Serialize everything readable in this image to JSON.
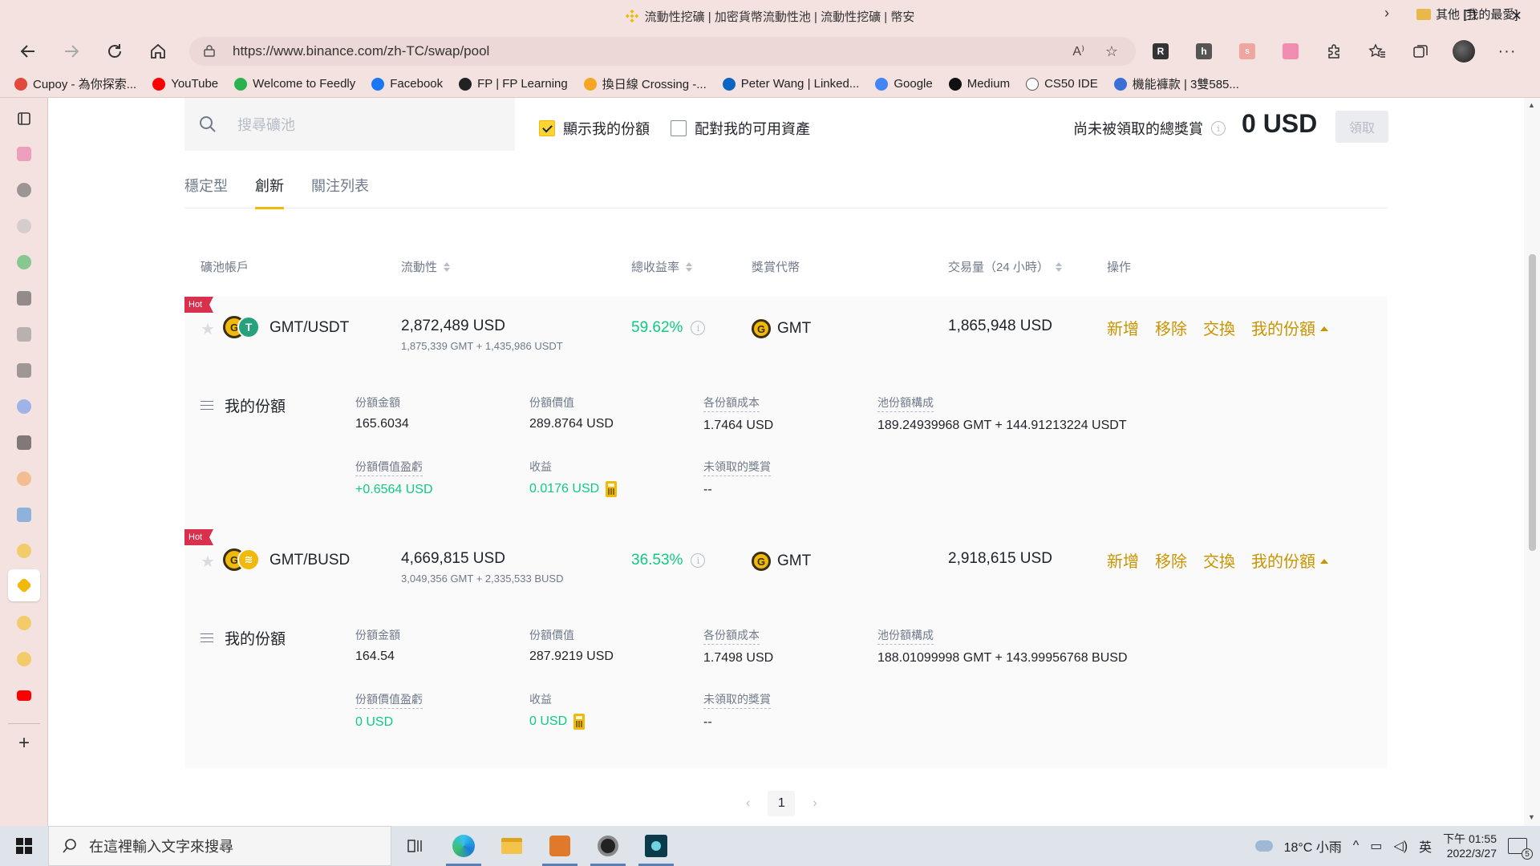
{
  "window": {
    "title": "流動性挖礦 | 加密貨幣流動性池 | 流動性挖礦 | 幣安",
    "minimize": "—",
    "maximize": "❐",
    "close": "✕"
  },
  "browser": {
    "url": "https://www.binance.com/zh-TC/swap/pool",
    "read_aloud": "A⁾",
    "fav": "☆"
  },
  "bookmarks": [
    {
      "label": "Cupoy - 為你探索...",
      "color": "#e04a3a"
    },
    {
      "label": "YouTube",
      "color": "#ff0000"
    },
    {
      "label": "Welcome to Feedly",
      "color": "#2bb24c"
    },
    {
      "label": "Facebook",
      "color": "#1877f2"
    },
    {
      "label": "FP | FP Learning",
      "color": "#222222"
    },
    {
      "label": "換日線 Crossing -...",
      "color": "#f5a623"
    },
    {
      "label": "Peter Wang | Linked...",
      "color": "#0a66c2"
    },
    {
      "label": "Google",
      "color": "#4285f4"
    },
    {
      "label": "Medium",
      "color": "#111111"
    },
    {
      "label": "CS50 IDE",
      "color": "#ffffff"
    },
    {
      "label": "機能褲款 | 3雙585...",
      "color": "#3a6fd8"
    }
  ],
  "bookmarks_other": "其他 [我的最愛]",
  "toolbar": {
    "search_placeholder": "搜尋礦池",
    "show_my_shares": "顯示我的份額",
    "match_my_assets": "配對我的可用資產",
    "unclaimed_label": "尚未被領取的總獎賞",
    "unclaimed_value": "0 USD",
    "claim_button": "領取"
  },
  "tabs": [
    {
      "label": "穩定型",
      "active": false
    },
    {
      "label": "創新",
      "active": true
    },
    {
      "label": "關注列表",
      "active": false
    }
  ],
  "table_headers": {
    "pool": "礦池帳戶",
    "liquidity": "流動性",
    "apy": "總收益率",
    "reward_token": "獎賞代幣",
    "volume": "交易量（24 小時）",
    "actions": "操作"
  },
  "pools": [
    {
      "badge": "Hot",
      "pair": "GMT/USDT",
      "liquidity": "2,872,489 USD",
      "liquidity_detail": "1,875,339 GMT + 1,435,986 USDT",
      "apy": "59.62%",
      "reward_token": "GMT",
      "volume": "1,865,948 USD",
      "actions": [
        "新增",
        "移除",
        "交換",
        "我的份額"
      ],
      "my_shares": {
        "title": "我的份額",
        "amount_label": "份額金額",
        "amount": "165.6034",
        "value_label": "份額價值",
        "value": "289.8764 USD",
        "cost_label": "各份額成本",
        "cost": "1.7464 USD",
        "composition_label": "池份額構成",
        "composition": "189.24939968 GMT + 144.91213224 USDT",
        "pnl_label": "份額價值盈虧",
        "pnl": "+0.6564 USD",
        "earnings_label": "收益",
        "earnings": "0.0176 USD",
        "unclaimed_label": "未領取的獎賞",
        "unclaimed": "--"
      }
    },
    {
      "badge": "Hot",
      "pair": "GMT/BUSD",
      "liquidity": "4,669,815 USD",
      "liquidity_detail": "3,049,356 GMT + 2,335,533 BUSD",
      "apy": "36.53%",
      "reward_token": "GMT",
      "volume": "2,918,615 USD",
      "actions": [
        "新增",
        "移除",
        "交換",
        "我的份額"
      ],
      "my_shares": {
        "title": "我的份額",
        "amount_label": "份額金額",
        "amount": "164.54",
        "value_label": "份額價值",
        "value": "287.9219 USD",
        "cost_label": "各份額成本",
        "cost": "1.7498 USD",
        "composition_label": "池份額構成",
        "composition": "188.01099998 GMT + 143.99956768 BUSD",
        "pnl_label": "份額價值盈虧",
        "pnl": "0 USD",
        "earnings_label": "收益",
        "earnings": "0 USD",
        "unclaimed_label": "未領取的獎賞",
        "unclaimed": "--"
      }
    }
  ],
  "pagination": {
    "current": "1",
    "prev": "‹",
    "next": "›"
  },
  "taskbar": {
    "search_placeholder": "在這裡輸入文字來搜尋",
    "weather": "18°C 小雨",
    "ime": "英",
    "time": "下午 01:55",
    "date": "2022/3/27",
    "notif_count": "5"
  },
  "colors": {
    "accent": "#f0b90b",
    "action_text": "#c99400",
    "positive": "#0ecb81",
    "hot_badge": "#d9304e",
    "browser_chrome": "#f3e2e0"
  }
}
